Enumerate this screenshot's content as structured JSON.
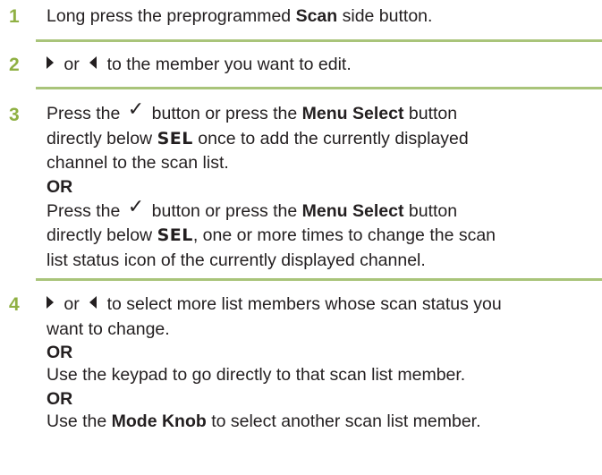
{
  "steps": [
    {
      "num": "1",
      "l1_a": "Long press the preprogrammed ",
      "l1_b": "Scan",
      "l1_c": " side button."
    },
    {
      "num": "2",
      "l1_a": " or ",
      "l1_b": " to the member you want to edit."
    },
    {
      "num": "3",
      "a_l1_a": "Press the ",
      "a_l1_b": " button or press the ",
      "a_l1_c": "Menu Select",
      "a_l1_d": " button",
      "a_l2_a": "directly below ",
      "a_l2_b": "SEL",
      "a_l2_c": " once to add the currently displayed",
      "a_l3": "channel to the scan list.",
      "or": "OR",
      "b_l1_a": "Press the ",
      "b_l1_b": " button or press the ",
      "b_l1_c": "Menu Select",
      "b_l1_d": " button",
      "b_l2_a": "directly below ",
      "b_l2_b": "SEL",
      "b_l2_c": ", one or more times to change the scan",
      "b_l3": "list status icon of the currently displayed channel."
    },
    {
      "num": "4",
      "l1_a": " or ",
      "l1_b": " to select more list members whose scan status you",
      "l2": "want to change.",
      "or1": "OR",
      "l3": "Use the keypad to go directly to that scan list member.",
      "or2": "OR",
      "l4_a": "Use the ",
      "l4_b": "Mode Knob",
      "l4_c": " to select another scan list member."
    }
  ],
  "icons": {
    "right": "right-arrow-icon",
    "left": "left-arrow-icon",
    "check": "checkmark-icon",
    "check_glyph": "✓"
  },
  "colors": {
    "step_number": "#8fb043",
    "rule": "#a9c47a",
    "text": "#231f20"
  }
}
